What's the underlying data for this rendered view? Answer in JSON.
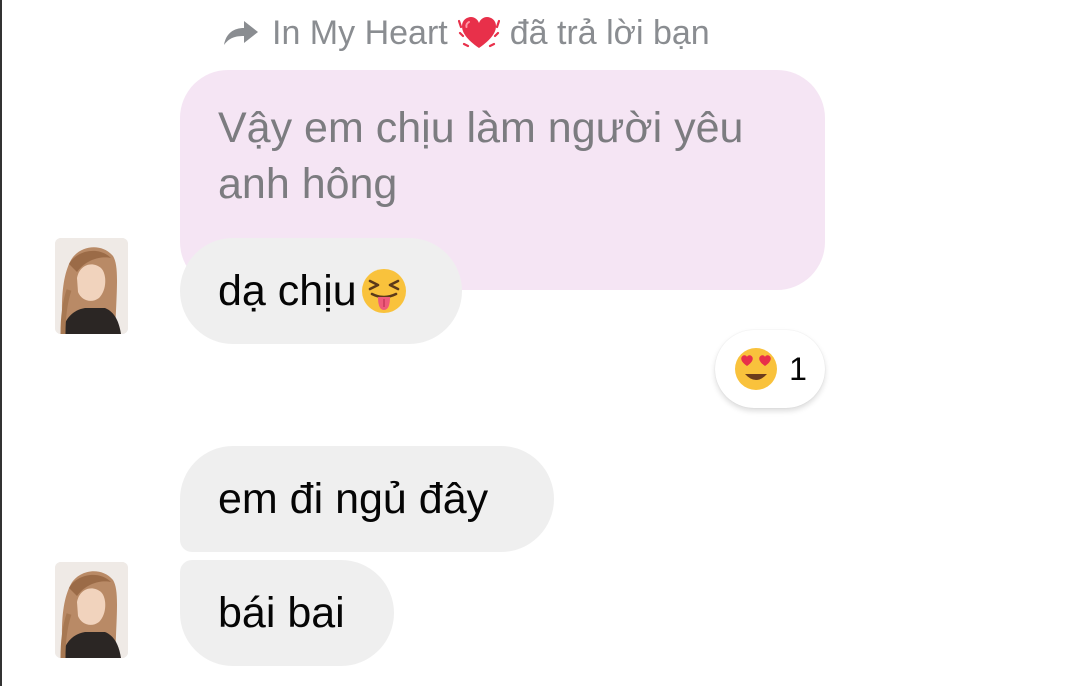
{
  "reply_header": {
    "sender": "In My Heart",
    "action": "đã trả lời bạn",
    "heart_icon": "beating-heart-icon",
    "arrow_icon": "reply-arrow-icon"
  },
  "quoted_message": {
    "text": "Vậy em chịu làm người yêu anh hông",
    "background": "#f5e5f4"
  },
  "messages": [
    {
      "text": "dạ chịu",
      "emoji": "squinting-tongue-face-icon"
    },
    {
      "text": "em đi ngủ đây"
    },
    {
      "text": "bái bai"
    }
  ],
  "reaction": {
    "emoji": "heart-eyes-face-icon",
    "count": "1"
  },
  "colors": {
    "bubble_bg": "#efefef",
    "quoted_bg": "#f5e5f4",
    "meta_text": "#8a8d91"
  }
}
